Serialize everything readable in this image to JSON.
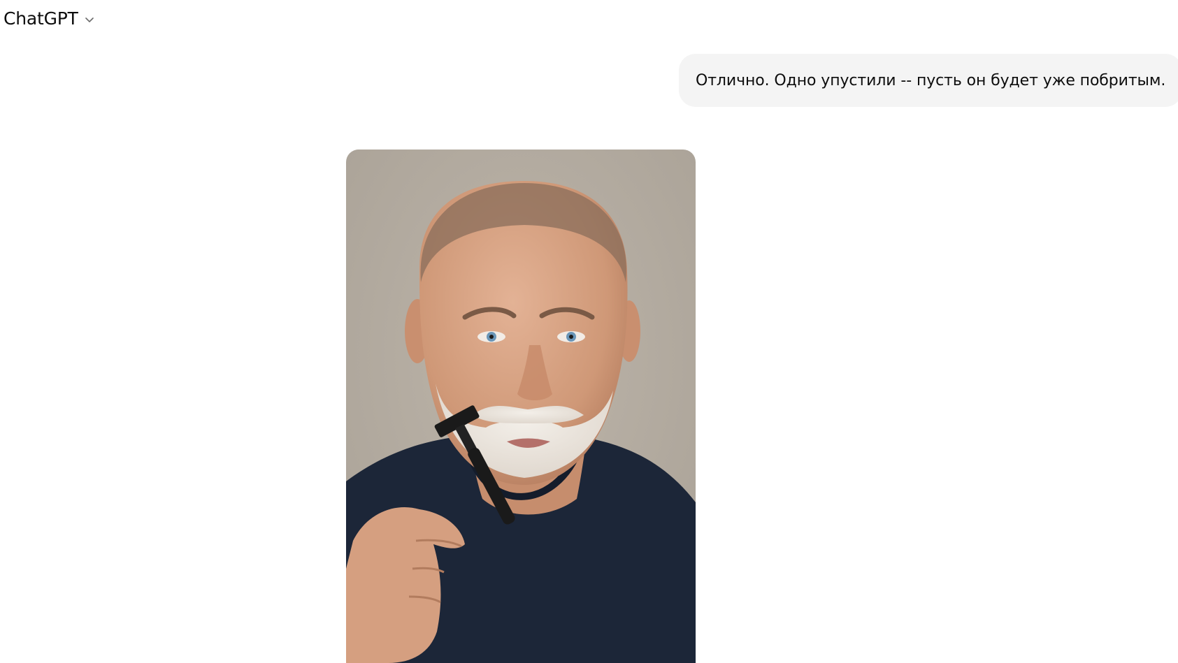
{
  "header": {
    "title": "ChatGPT",
    "model_menu_icon": "chevron-down-icon"
  },
  "conversation": {
    "user_message": "Отлично. Одно упустили -- пусть он будет уже побритым.",
    "assistant_image": {
      "subject": "photo",
      "colors": {
        "background": "#b7afa4",
        "skin": "#d9a585",
        "shirt": "#1c2638",
        "foam": "#ece7e0",
        "razor": "#1a1a1a",
        "eyes": "#6a96b8"
      }
    }
  }
}
